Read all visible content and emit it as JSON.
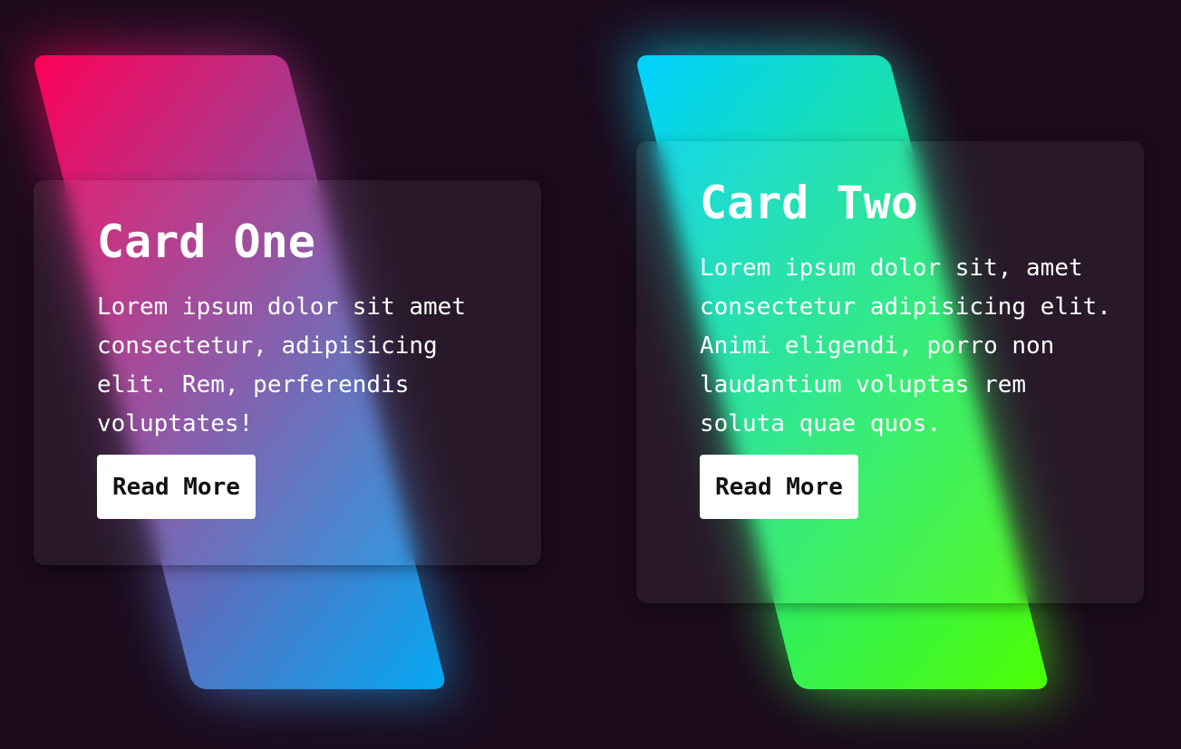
{
  "colors": {
    "background": "#1b0a1c",
    "card_one_gradient_start": "#ff0058",
    "card_one_gradient_end": "#03a9f4",
    "card_two_gradient_start": "#00d0ff",
    "card_two_gradient_end": "#4dff03",
    "button_background": "#ffffff"
  },
  "cards": [
    {
      "title": "Card One",
      "text": "Lorem ipsum dolor sit amet consectetur, adipisicing elit. Rem, perferendis voluptates!",
      "button_label": "Read More"
    },
    {
      "title": "Card Two",
      "text": "Lorem ipsum dolor sit, amet consectetur adipisicing elit. Animi eligendi, porro non laudantium voluptas rem soluta quae quos.",
      "button_label": "Read More"
    }
  ]
}
